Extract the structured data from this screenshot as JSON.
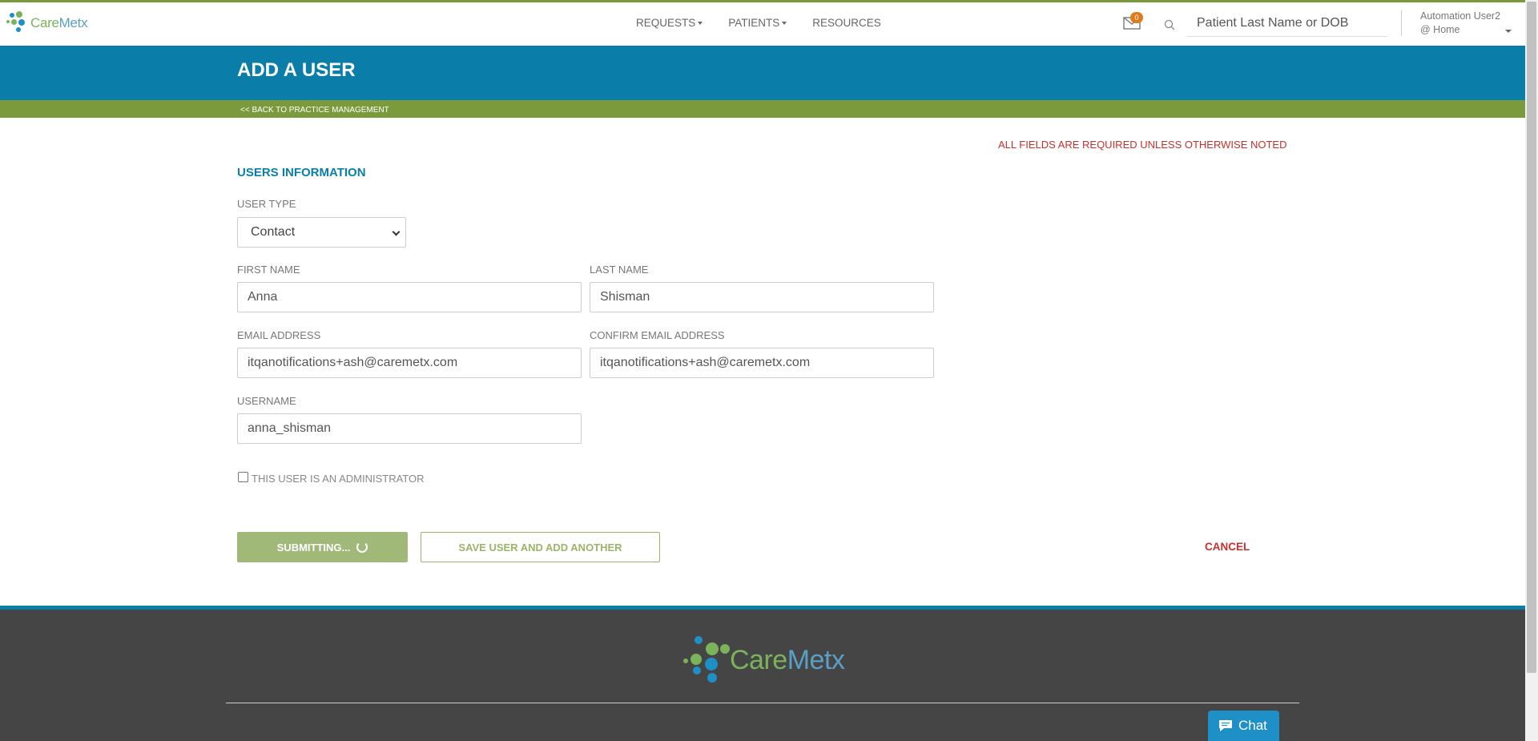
{
  "brand": {
    "logo_text_a": "Care",
    "logo_text_b": "Metx"
  },
  "nav": {
    "requests": "REQUESTS",
    "patients": "PATIENTS",
    "resources": "RESOURCES"
  },
  "header": {
    "mail_count": "0",
    "search_placeholder": "Patient Last Name or DOB",
    "user_name": "Automation User2",
    "user_location": "@ Home"
  },
  "page": {
    "title": "ADD A USER",
    "back_link": "<< BACK TO PRACTICE MANAGEMENT",
    "required_note": "ALL FIELDS ARE REQUIRED UNLESS OTHERWISE NOTED",
    "section_title": "USERS INFORMATION"
  },
  "form": {
    "user_type_label": "USER TYPE",
    "user_type_value": "Contact",
    "first_name_label": "FIRST NAME",
    "first_name_value": "Anna",
    "last_name_label": "LAST NAME",
    "last_name_value": "Shisman",
    "email_label": "EMAIL ADDRESS",
    "email_value": "itqanotifications+ash@caremetx.com",
    "confirm_email_label": "CONFIRM EMAIL ADDRESS",
    "confirm_email_value": "itqanotifications+ash@caremetx.com",
    "username_label": "USERNAME",
    "username_value": "anna_shisman",
    "admin_label": "THIS USER IS AN ADMINISTRATOR"
  },
  "actions": {
    "submit": "SUBMITTING...",
    "save_add": "SAVE USER AND ADD ANOTHER",
    "cancel": "CANCEL"
  },
  "footer": {
    "chat": "Chat"
  },
  "colors": {
    "brand_blue": "#0a7ea8",
    "brand_green": "#7a9a3c",
    "error_red": "#c8302b",
    "footer_bg": "#454545"
  }
}
